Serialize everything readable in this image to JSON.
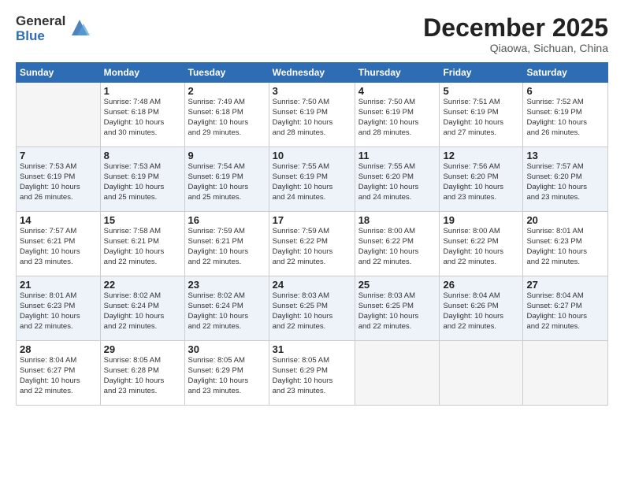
{
  "logo": {
    "general": "General",
    "blue": "Blue"
  },
  "title": "December 2025",
  "location": "Qiaowa, Sichuan, China",
  "weekdays": [
    "Sunday",
    "Monday",
    "Tuesday",
    "Wednesday",
    "Thursday",
    "Friday",
    "Saturday"
  ],
  "weeks": [
    [
      {
        "day": "",
        "info": ""
      },
      {
        "day": "1",
        "info": "Sunrise: 7:48 AM\nSunset: 6:18 PM\nDaylight: 10 hours\nand 30 minutes."
      },
      {
        "day": "2",
        "info": "Sunrise: 7:49 AM\nSunset: 6:18 PM\nDaylight: 10 hours\nand 29 minutes."
      },
      {
        "day": "3",
        "info": "Sunrise: 7:50 AM\nSunset: 6:19 PM\nDaylight: 10 hours\nand 28 minutes."
      },
      {
        "day": "4",
        "info": "Sunrise: 7:50 AM\nSunset: 6:19 PM\nDaylight: 10 hours\nand 28 minutes."
      },
      {
        "day": "5",
        "info": "Sunrise: 7:51 AM\nSunset: 6:19 PM\nDaylight: 10 hours\nand 27 minutes."
      },
      {
        "day": "6",
        "info": "Sunrise: 7:52 AM\nSunset: 6:19 PM\nDaylight: 10 hours\nand 26 minutes."
      }
    ],
    [
      {
        "day": "7",
        "info": "Sunrise: 7:53 AM\nSunset: 6:19 PM\nDaylight: 10 hours\nand 26 minutes."
      },
      {
        "day": "8",
        "info": "Sunrise: 7:53 AM\nSunset: 6:19 PM\nDaylight: 10 hours\nand 25 minutes."
      },
      {
        "day": "9",
        "info": "Sunrise: 7:54 AM\nSunset: 6:19 PM\nDaylight: 10 hours\nand 25 minutes."
      },
      {
        "day": "10",
        "info": "Sunrise: 7:55 AM\nSunset: 6:19 PM\nDaylight: 10 hours\nand 24 minutes."
      },
      {
        "day": "11",
        "info": "Sunrise: 7:55 AM\nSunset: 6:20 PM\nDaylight: 10 hours\nand 24 minutes."
      },
      {
        "day": "12",
        "info": "Sunrise: 7:56 AM\nSunset: 6:20 PM\nDaylight: 10 hours\nand 23 minutes."
      },
      {
        "day": "13",
        "info": "Sunrise: 7:57 AM\nSunset: 6:20 PM\nDaylight: 10 hours\nand 23 minutes."
      }
    ],
    [
      {
        "day": "14",
        "info": "Sunrise: 7:57 AM\nSunset: 6:21 PM\nDaylight: 10 hours\nand 23 minutes."
      },
      {
        "day": "15",
        "info": "Sunrise: 7:58 AM\nSunset: 6:21 PM\nDaylight: 10 hours\nand 22 minutes."
      },
      {
        "day": "16",
        "info": "Sunrise: 7:59 AM\nSunset: 6:21 PM\nDaylight: 10 hours\nand 22 minutes."
      },
      {
        "day": "17",
        "info": "Sunrise: 7:59 AM\nSunset: 6:22 PM\nDaylight: 10 hours\nand 22 minutes."
      },
      {
        "day": "18",
        "info": "Sunrise: 8:00 AM\nSunset: 6:22 PM\nDaylight: 10 hours\nand 22 minutes."
      },
      {
        "day": "19",
        "info": "Sunrise: 8:00 AM\nSunset: 6:22 PM\nDaylight: 10 hours\nand 22 minutes."
      },
      {
        "day": "20",
        "info": "Sunrise: 8:01 AM\nSunset: 6:23 PM\nDaylight: 10 hours\nand 22 minutes."
      }
    ],
    [
      {
        "day": "21",
        "info": "Sunrise: 8:01 AM\nSunset: 6:23 PM\nDaylight: 10 hours\nand 22 minutes."
      },
      {
        "day": "22",
        "info": "Sunrise: 8:02 AM\nSunset: 6:24 PM\nDaylight: 10 hours\nand 22 minutes."
      },
      {
        "day": "23",
        "info": "Sunrise: 8:02 AM\nSunset: 6:24 PM\nDaylight: 10 hours\nand 22 minutes."
      },
      {
        "day": "24",
        "info": "Sunrise: 8:03 AM\nSunset: 6:25 PM\nDaylight: 10 hours\nand 22 minutes."
      },
      {
        "day": "25",
        "info": "Sunrise: 8:03 AM\nSunset: 6:25 PM\nDaylight: 10 hours\nand 22 minutes."
      },
      {
        "day": "26",
        "info": "Sunrise: 8:04 AM\nSunset: 6:26 PM\nDaylight: 10 hours\nand 22 minutes."
      },
      {
        "day": "27",
        "info": "Sunrise: 8:04 AM\nSunset: 6:27 PM\nDaylight: 10 hours\nand 22 minutes."
      }
    ],
    [
      {
        "day": "28",
        "info": "Sunrise: 8:04 AM\nSunset: 6:27 PM\nDaylight: 10 hours\nand 22 minutes."
      },
      {
        "day": "29",
        "info": "Sunrise: 8:05 AM\nSunset: 6:28 PM\nDaylight: 10 hours\nand 23 minutes."
      },
      {
        "day": "30",
        "info": "Sunrise: 8:05 AM\nSunset: 6:29 PM\nDaylight: 10 hours\nand 23 minutes."
      },
      {
        "day": "31",
        "info": "Sunrise: 8:05 AM\nSunset: 6:29 PM\nDaylight: 10 hours\nand 23 minutes."
      },
      {
        "day": "",
        "info": ""
      },
      {
        "day": "",
        "info": ""
      },
      {
        "day": "",
        "info": ""
      }
    ]
  ]
}
